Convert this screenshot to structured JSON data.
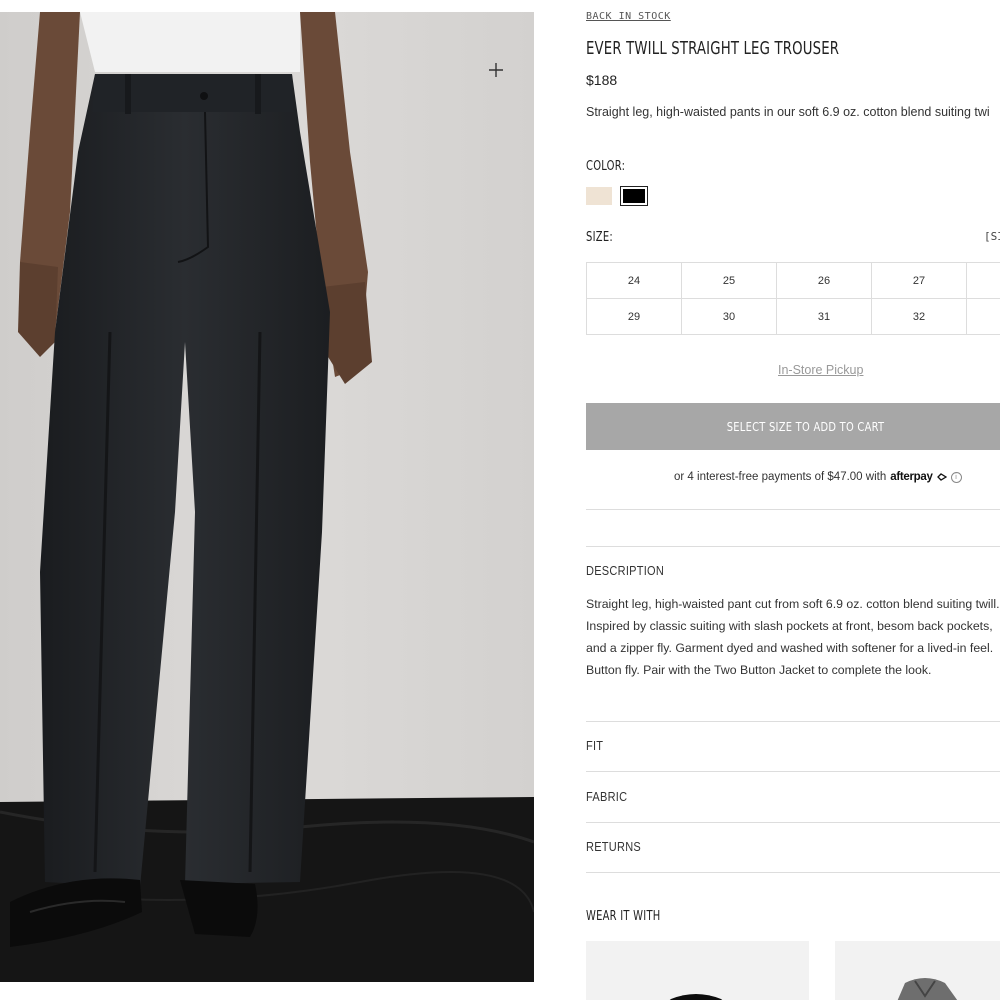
{
  "product": {
    "stock_status": "BACK IN STOCK",
    "title": "EVER TWILL STRAIGHT LEG TROUSER",
    "price": "$188",
    "short_description": "Straight leg, high-waisted pants in our soft 6.9 oz. cotton blend suiting twi"
  },
  "color": {
    "label": "COLOR:",
    "swatches": [
      {
        "name": "cream",
        "hex": "#efe3d4"
      },
      {
        "name": "black",
        "hex": "#000000",
        "selected": true
      }
    ]
  },
  "size": {
    "label": "SIZE:",
    "guide_label": "[SIZ",
    "options": [
      "24",
      "25",
      "26",
      "27",
      "",
      "29",
      "30",
      "31",
      "32",
      ""
    ]
  },
  "pickup_label": "In-Store Pickup",
  "cart_button_label": "SELECT SIZE TO ADD TO CART",
  "afterpay": {
    "text": "or 4 interest-free payments of $47.00 with",
    "brand": "afterpay",
    "info": "i"
  },
  "description": {
    "heading": "DESCRIPTION",
    "body": "Straight leg, high-waisted pant cut from soft 6.9 oz. cotton blend suiting twill. Inspired by classic suiting with slash pockets at front, besom back pockets, and a zipper fly. Garment dyed and washed with softener for a lived-in feel. Button fly. Pair with the Two Button Jacket to complete the look."
  },
  "accordions": [
    "FIT",
    "FABRIC",
    "RETURNS"
  ],
  "wear_it_with": {
    "heading": "WEAR IT WITH"
  },
  "colors": {
    "cart_button": "#a7a7a7",
    "divider": "#dddddd"
  }
}
